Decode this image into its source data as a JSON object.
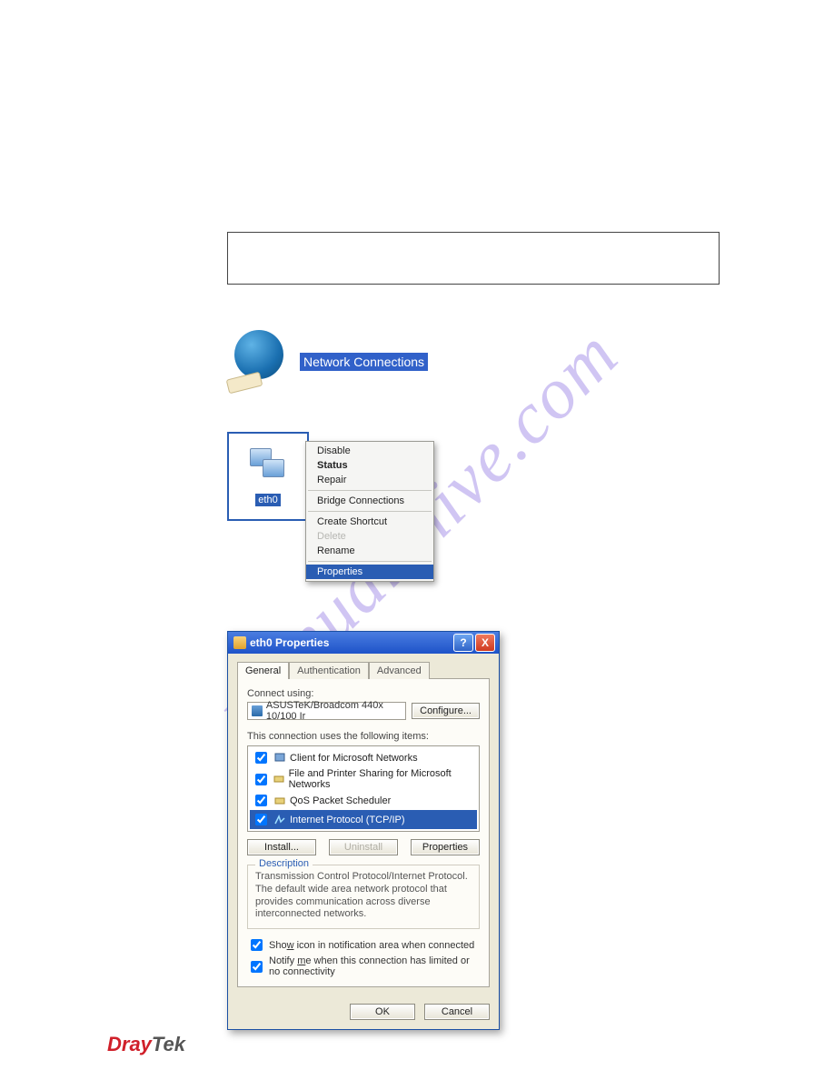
{
  "watermark": "manualshive.com",
  "network_connections": {
    "label": "Network Connections"
  },
  "eth_thumb": {
    "label": "eth0"
  },
  "context_menu": {
    "items": [
      {
        "label": "Disable"
      },
      {
        "label": "Status"
      },
      {
        "label": "Repair"
      },
      {
        "label": "Bridge Connections"
      },
      {
        "label": "Create Shortcut"
      },
      {
        "label": "Delete"
      },
      {
        "label": "Rename"
      },
      {
        "label": "Properties"
      }
    ]
  },
  "dialog": {
    "title": "eth0 Properties",
    "help_glyph": "?",
    "close_glyph": "X",
    "tabs": [
      "General",
      "Authentication",
      "Advanced"
    ],
    "connect_using_label": "Connect using:",
    "adapter": "ASUSTeK/Broadcom 440x 10/100 Ir",
    "configure_btn": "Configure...",
    "items_heading": "This connection uses the following items:",
    "items": [
      "Client for Microsoft Networks",
      "File and Printer Sharing for Microsoft Networks",
      "QoS Packet Scheduler",
      "Internet Protocol (TCP/IP)"
    ],
    "install_btn": "Install...",
    "uninstall_btn": "Uninstall",
    "properties_btn": "Properties",
    "description_legend": "Description",
    "description_body": "Transmission Control Protocol/Internet Protocol. The default wide area network protocol that provides communication across diverse interconnected networks.",
    "show_icon_pre": "Sho",
    "show_icon_u": "w",
    "show_icon_post": " icon in notification area when connected",
    "notify_pre": "Notify ",
    "notify_u": "m",
    "notify_post": "e when this connection has limited or no connectivity",
    "ok_btn": "OK",
    "cancel_btn": "Cancel"
  },
  "footer": {
    "dray": "Dray",
    "tek": "Tek"
  }
}
